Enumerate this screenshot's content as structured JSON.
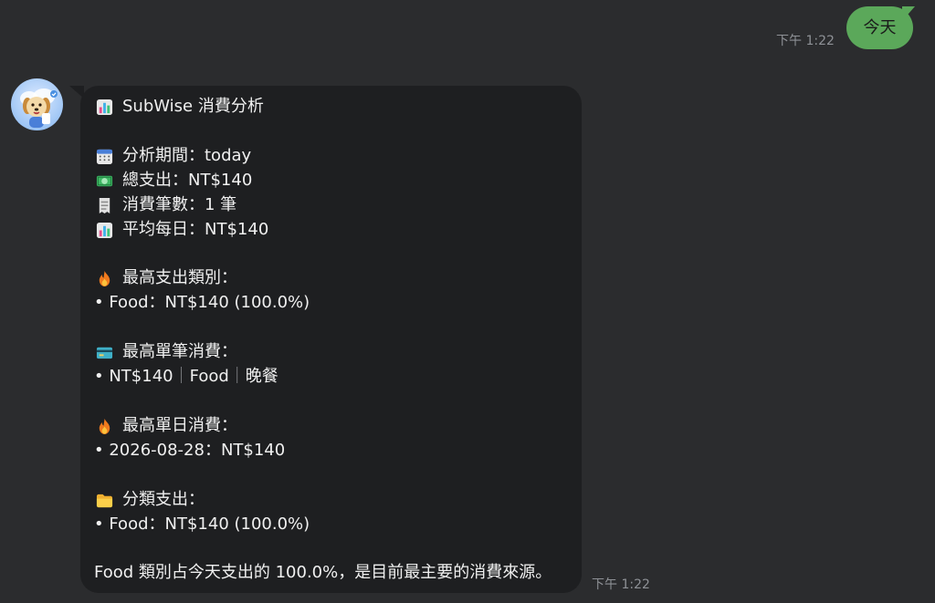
{
  "outgoing_message": {
    "text": "今天",
    "time": "下午 1:22"
  },
  "incoming_message": {
    "time": "下午 1:22",
    "title": "SubWise 消費分析",
    "period": "分析期間：today",
    "total": "總支出：NT$140",
    "count": "消費筆數：1 筆",
    "daily_avg": "平均每日：NT$140",
    "top_category_heading": "最高支出類別：",
    "top_category_item": "• Food：NT$140 (100.0%)",
    "top_single_heading": "最高單筆消費：",
    "top_single_prefix": "• NT$140",
    "top_single_sep1": "｜",
    "top_single_category": "Food",
    "top_single_sep2": "｜",
    "top_single_note": "晚餐",
    "top_day_heading": "最高單日消費：",
    "top_day_item": "• 2026-08-28：NT$140",
    "category_heading": "分類支出：",
    "category_item": "• Food：NT$140 (100.0%)",
    "summary": "Food 類別占今天支出的 100.0%，是目前最主要的消費來源。"
  },
  "icons": {
    "title": "bar-chart-icon",
    "period": "calendar-icon",
    "total": "money-icon",
    "count": "receipt-icon",
    "daily_avg": "bar-chart-icon",
    "top_category": "fire-icon",
    "top_single": "credit-card-icon",
    "top_day": "fire-icon",
    "category": "folder-icon"
  },
  "colors": {
    "background": "#2b2c2e",
    "outgoing_bubble": "#5ba85a",
    "incoming_bubble": "#1e1f21",
    "timestamp": "#8e9196"
  }
}
